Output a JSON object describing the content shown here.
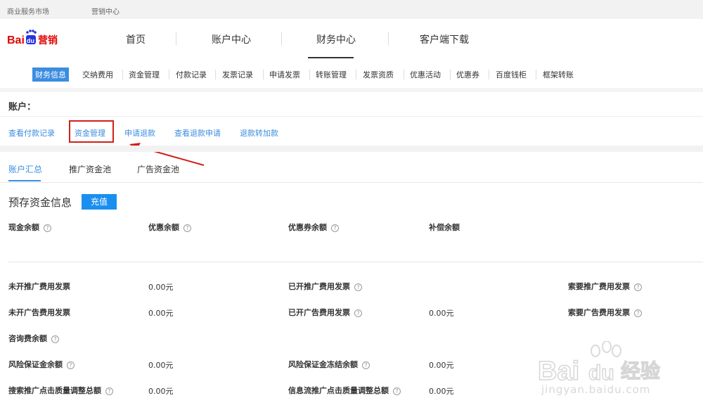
{
  "topbar": {
    "market": "商业服务市场",
    "center": "营销中心"
  },
  "brand": {
    "logo_text_a": "Bai",
    "logo_text_b": "du",
    "logo_text_c": "营销"
  },
  "nav": {
    "items": [
      "首页",
      "账户中心",
      "财务中心",
      "客户端下载"
    ],
    "active": "财务中心"
  },
  "subnav": {
    "items": [
      "财务信息",
      "交纳费用",
      "资金管理",
      "付款记录",
      "发票记录",
      "申请发票",
      "转账管理",
      "发票资质",
      "优惠活动",
      "优惠券",
      "百度钱柜",
      "框架转账"
    ],
    "active": "财务信息"
  },
  "account": {
    "title": "账户：",
    "links": [
      "查看付款记录",
      "资金管理",
      "申请退款",
      "查看退款申请",
      "退款转加款"
    ],
    "highlighted": "资金管理"
  },
  "tabs": {
    "items": [
      "账户汇总",
      "推广资金池",
      "广告资金池"
    ],
    "active": "账户汇总"
  },
  "deposit": {
    "title": "预存资金信息",
    "recharge_label": "充值",
    "help_icon": "?",
    "fields": {
      "cash_balance": "现金余额",
      "discount_balance": "优惠余额",
      "coupon_balance": "优惠券余额",
      "compensation_balance": "补偿余额"
    }
  },
  "details": {
    "r1": {
      "l1": "未开推广费用发票",
      "v1": "0.00元",
      "l2": "已开推广费用发票",
      "l3": "索要推广费用发票"
    },
    "r2": {
      "l1": "未开广告费用发票",
      "v1": "0.00元",
      "l2": "已开广告费用发票",
      "v2": "0.00元",
      "l3": "索要广告费用发票"
    },
    "r3": {
      "l1": "咨询费余额"
    },
    "r4": {
      "l1": "风险保证金余额",
      "v1": "0.00元",
      "l2": "风险保证金冻结余额",
      "v2": "0.00元"
    },
    "r5": {
      "l1": "搜索推广点击质量调整总额",
      "v1": "0.00元",
      "l2": "信息流推广点击质量调整总额",
      "v2": "0.00元"
    }
  },
  "watermark": {
    "brand_a": "Bai",
    "brand_b": "du",
    "brand_c": "经验",
    "url": "jingyan.baidu.com"
  },
  "colors": {
    "accent": "#3b8de0",
    "button": "#1a8ff0",
    "highlight": "#d0201a",
    "logo_blue": "#2932e1",
    "logo_red": "#e10602"
  }
}
